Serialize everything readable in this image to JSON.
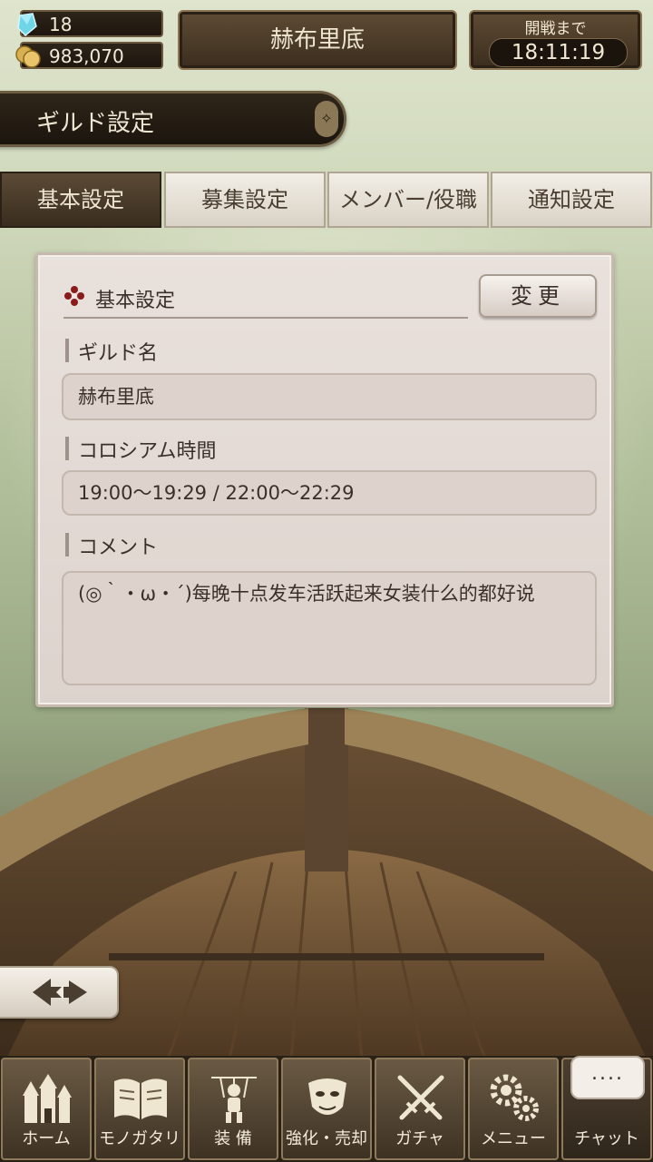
{
  "header": {
    "gems": "18",
    "gold": "983,070",
    "guild_name": "赫布里底",
    "timer_label": "開戦まで",
    "timer_value": "18:11:19"
  },
  "title_bar": {
    "title": "ギルド設定"
  },
  "tabs": [
    {
      "label": "基本設定",
      "active": true
    },
    {
      "label": "募集設定",
      "active": false
    },
    {
      "label": "メンバー/役職",
      "active": false
    },
    {
      "label": "通知設定",
      "active": false
    }
  ],
  "panel": {
    "heading": "基本設定",
    "change_button": "変更",
    "fields": [
      {
        "label": "ギルド名",
        "value": "赫布里底"
      },
      {
        "label": "コロシアム時間",
        "value": "19:00〜19:29 / 22:00〜22:29"
      },
      {
        "label": "コメント",
        "value": "(◎｀・ω・´)每晚十点发车活跃起来女装什么的都好说"
      }
    ]
  },
  "bottom_nav": [
    {
      "label": "ホーム",
      "icon": "castle-icon"
    },
    {
      "label": "モノガタリ",
      "icon": "book-icon"
    },
    {
      "label": "装 備",
      "icon": "puppet-icon"
    },
    {
      "label": "強化・売却",
      "icon": "mask-hand-icon"
    },
    {
      "label": "ガチャ",
      "icon": "crossed-swords-icon"
    },
    {
      "label": "メニュー",
      "icon": "gears-icon"
    },
    {
      "label": "チャット",
      "icon": "chat-bubble-icon",
      "bubble": "...."
    }
  ],
  "colors": {
    "accent_dark": "#3a2d1f",
    "panel_bg": "#e9e1dc",
    "text_dark": "#3b3029",
    "heading_icon": "#8a1c1c"
  }
}
